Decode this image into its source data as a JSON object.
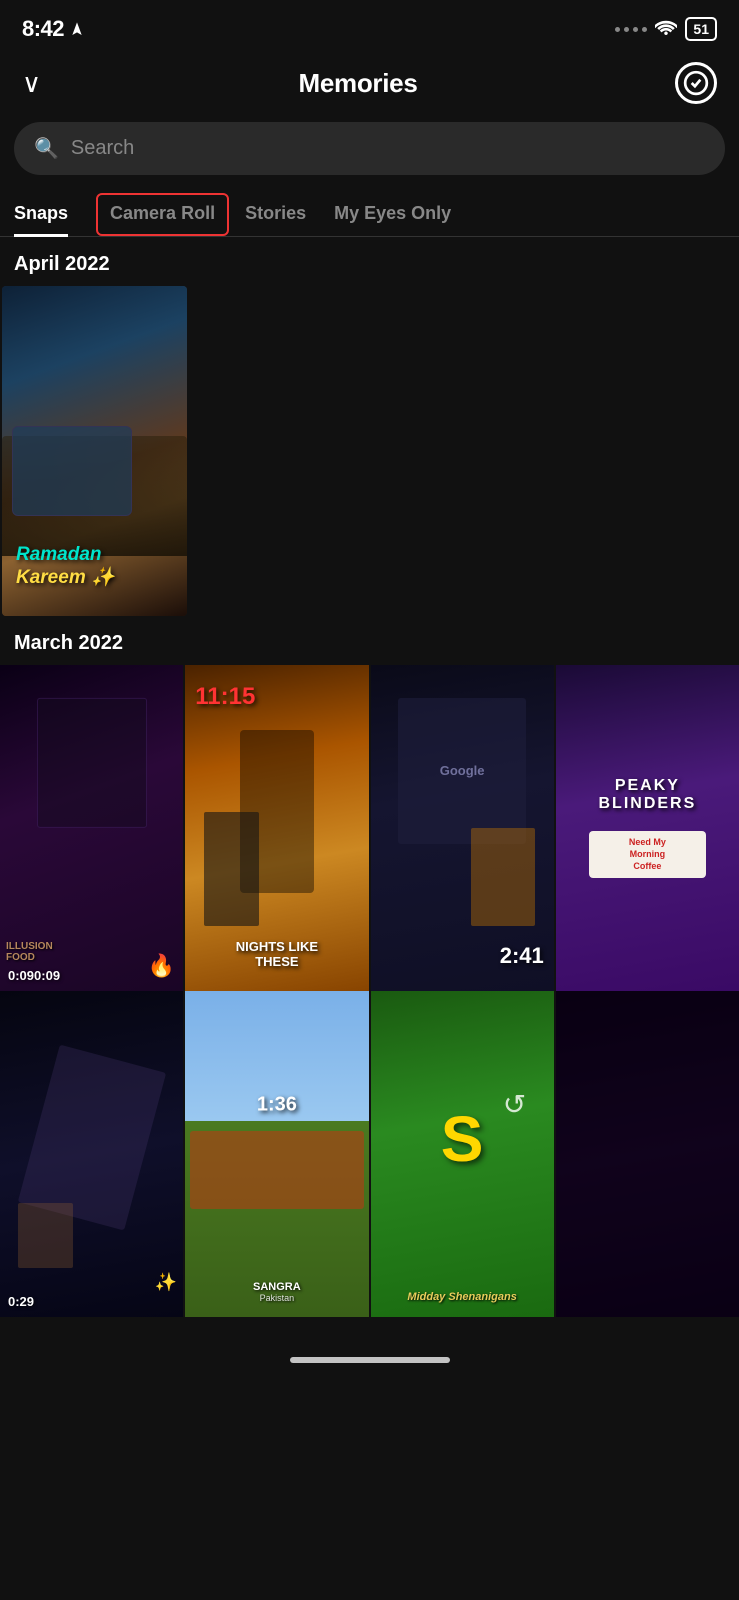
{
  "statusBar": {
    "time": "8:42",
    "battery": "51",
    "hasLocation": true
  },
  "header": {
    "title": "Memories",
    "chevronLabel": "Back",
    "checkLabel": "Select"
  },
  "search": {
    "placeholder": "Search"
  },
  "tabs": [
    {
      "id": "snaps",
      "label": "Snaps",
      "active": true,
      "highlighted": false
    },
    {
      "id": "camera-roll",
      "label": "Camera Roll",
      "active": false,
      "highlighted": true
    },
    {
      "id": "stories",
      "label": "Stories",
      "active": false,
      "highlighted": false
    },
    {
      "id": "my-eyes-only",
      "label": "My Eyes Only",
      "active": false,
      "highlighted": false
    }
  ],
  "sections": [
    {
      "id": "april-2022",
      "label": "April 2022",
      "type": "single",
      "items": [
        {
          "id": "snap-april-1",
          "overlayLine1": "Ramadan",
          "overlayLine2": "Kareem ✨",
          "duration": null
        }
      ]
    },
    {
      "id": "march-2022",
      "label": "March 2022",
      "type": "grid4",
      "rows": [
        [
          {
            "id": "snap-m1",
            "duration": "0:09",
            "textOverlay": "ILLUSION FOOD",
            "bgClass": "bg-dark-purple"
          },
          {
            "id": "snap-m2",
            "timeOverlay": "11:15",
            "textOverlay": "NIGHTS LIKE THESE",
            "bgClass": "bg-orange-cafe"
          },
          {
            "id": "snap-m3",
            "timeOverlay": "2:41",
            "textOverlay": "",
            "bgClass": "bg-dark-tech"
          },
          {
            "id": "snap-m4",
            "textOverlay": "PEAKY BLINDERS",
            "subText": "Need My Morning Coffee",
            "bgClass": "bg-purple-text"
          }
        ],
        [
          {
            "id": "snap-m5",
            "duration": "0:29",
            "bgClass": "bg-dark-night"
          },
          {
            "id": "snap-m6",
            "timeOverlay": "1:36",
            "subText": "SANGRA\nPakistan",
            "bgClass": "bg-green-road"
          },
          {
            "id": "snap-m7",
            "textOverlay": "S",
            "subText": "Midday Shenanigans",
            "bgClass": "bg-green-snap"
          },
          {
            "id": "snap-m8",
            "bgClass": "bg-dark-purple"
          }
        ]
      ]
    }
  ],
  "homeIndicator": true
}
